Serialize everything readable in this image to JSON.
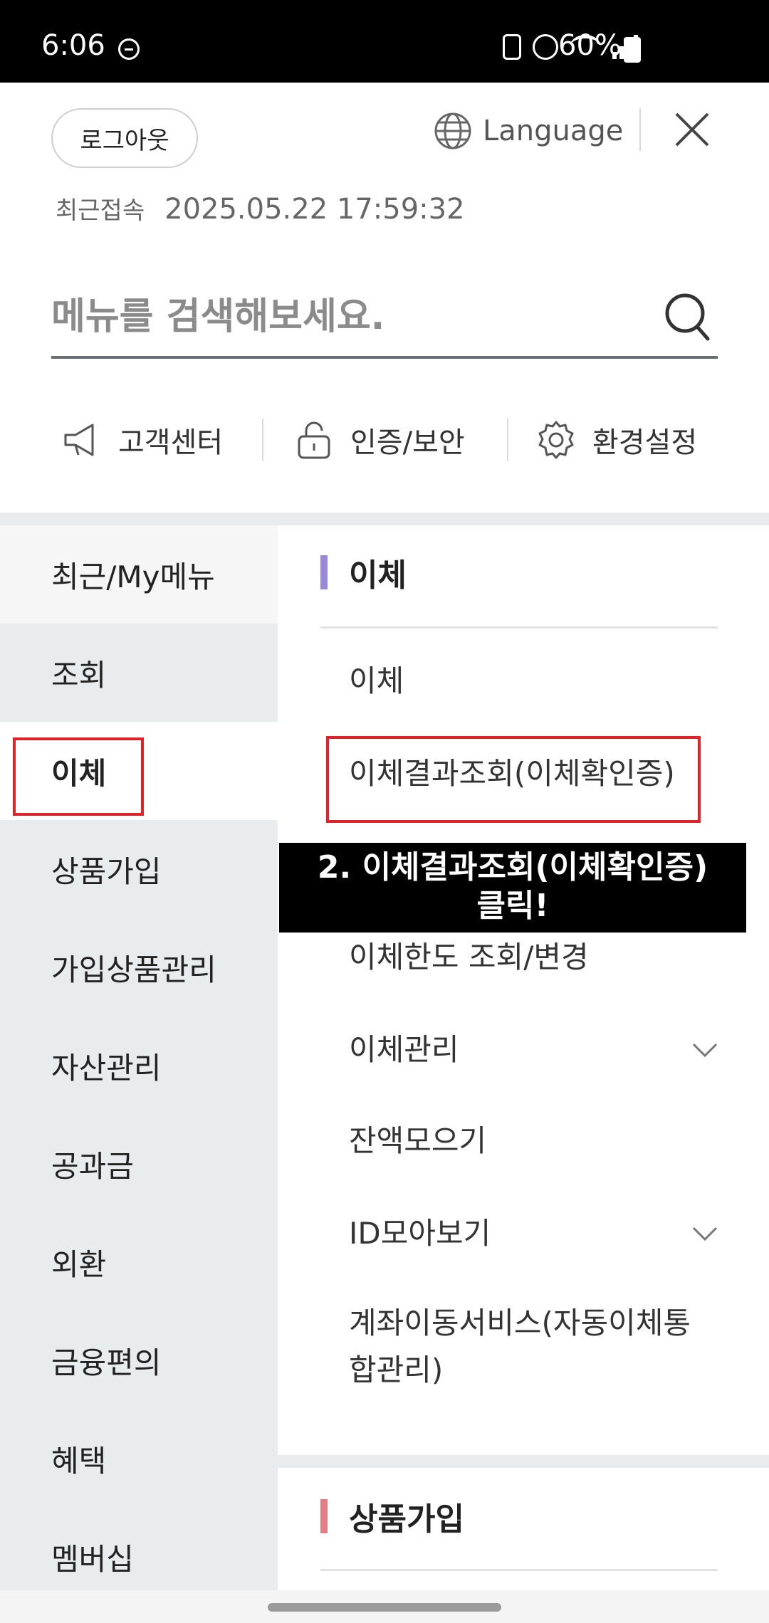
{
  "status_bar": {
    "time": "6:06",
    "battery": "60%"
  },
  "header": {
    "logout_label": "로그아웃",
    "language_label": "Language",
    "last_access_label": "최근접속",
    "last_access_time": "2025.05.22 17:59:32"
  },
  "search": {
    "placeholder": "메뉴를 검색해보세요."
  },
  "quick_menu": [
    {
      "label": "고객센터",
      "icon": "megaphone-icon"
    },
    {
      "label": "인증/보안",
      "icon": "lock-icon"
    },
    {
      "label": "환경설정",
      "icon": "gear-icon"
    }
  ],
  "left_nav": [
    "최근/My메뉴",
    "조회",
    "이체",
    "상품가입",
    "가입상품관리",
    "자산관리",
    "공과금",
    "외환",
    "금융편의",
    "혜택",
    "멤버십"
  ],
  "transfer_section": {
    "title": "이체",
    "items": [
      {
        "label": "이체"
      },
      {
        "label": "이체결과조회(이체확인증)"
      },
      {
        "label": "이체한도 조회/변경"
      },
      {
        "label": "이체관리"
      },
      {
        "label": "잔액모으기"
      },
      {
        "label": "ID모아보기"
      },
      {
        "label": "계좌이동서비스(자동이체통"
      },
      {
        "label": "합관리)"
      }
    ]
  },
  "product_section": {
    "title": "상품가입"
  },
  "overlay": {
    "line1": "2. 이체결과조회(이체확인증)",
    "line2": "클릭!"
  },
  "colors": {
    "highlight": "#e0232b",
    "nav_bg": "#e9ecef",
    "transfer_bar": "#9a8ad6",
    "product_bar": "#e07f86"
  }
}
